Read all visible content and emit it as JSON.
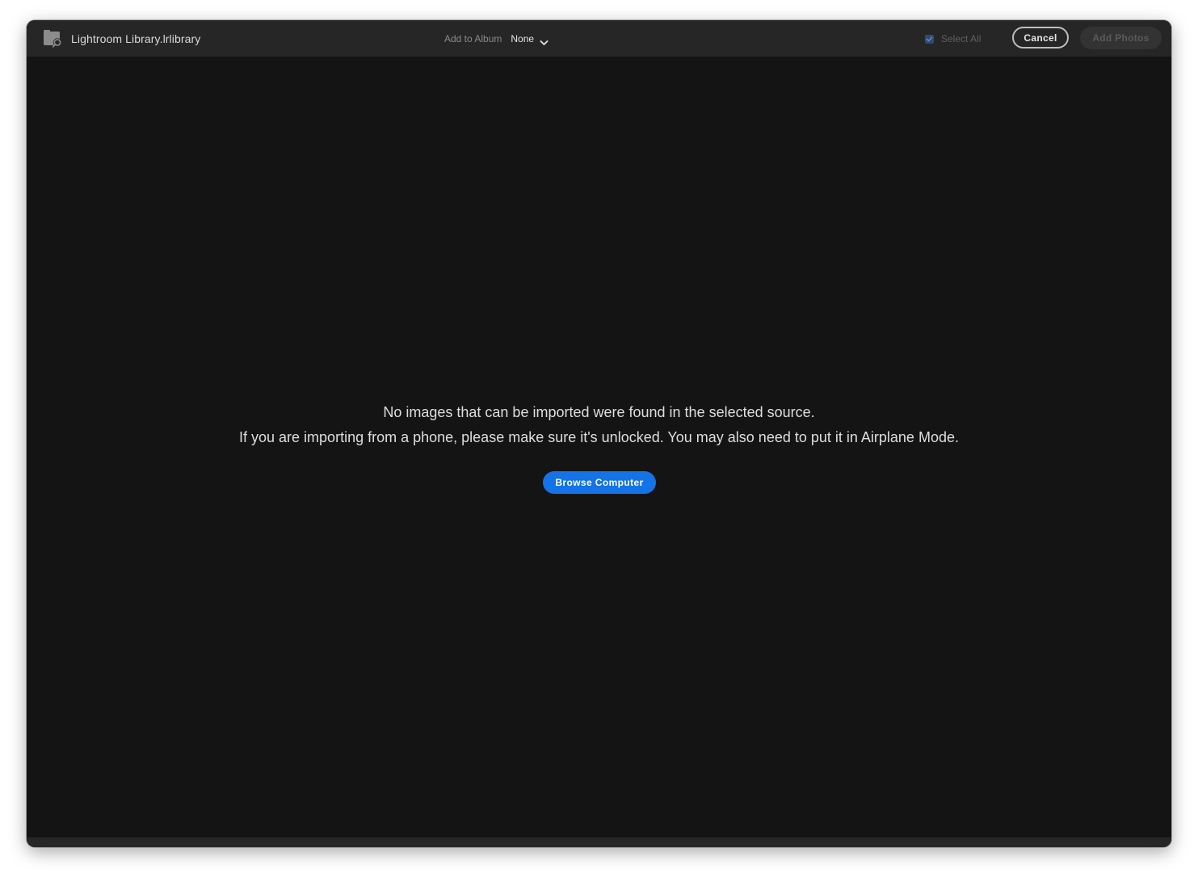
{
  "header": {
    "source_label": "Lightroom Library.lrlibrary",
    "add_to_album_label": "Add to Album",
    "album_selected": "None",
    "select_all_label": "Select All",
    "select_all_checked": true,
    "cancel_label": "Cancel",
    "add_photos_label": "Add Photos"
  },
  "main": {
    "message_line1": "No images that can be imported were found in the selected source.",
    "message_line2": "If you are importing from a phone, please make sure it's unlocked. You may also need to put it in Airplane Mode.",
    "browse_label": "Browse Computer"
  },
  "icons": {
    "source": "folder-search-icon",
    "album_dropdown": "chevron-down-icon",
    "select_all": "checkbox-checked-icon"
  },
  "colors": {
    "accent": "#1473e6",
    "window_bg": "#141414",
    "titlebar_bg": "#262626"
  }
}
